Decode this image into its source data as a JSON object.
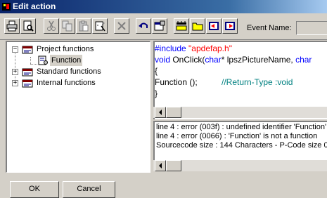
{
  "window": {
    "title": "Edit action"
  },
  "toolbar": {
    "buttons": [
      "print-icon",
      "print-preview-icon",
      "cut-icon",
      "copy-icon",
      "paste-icon",
      "wizard-icon",
      "delete-icon",
      "undo-icon",
      "properties-icon",
      "compile-icon",
      "folder-icon",
      "import-icon",
      "export-icon"
    ],
    "event_name_label": "Event Name:",
    "event_name_value": ""
  },
  "tree": {
    "items": [
      {
        "label": "Project functions",
        "expanded": true
      },
      {
        "label": "Function",
        "selected": true
      },
      {
        "label": "Standard functions",
        "expanded": false
      },
      {
        "label": "Internal functions",
        "expanded": false
      }
    ]
  },
  "code": {
    "line1_directive": "#include ",
    "line1_string": "\"apdefap.h\"",
    "line2_kw1": "void",
    "line2_text1": " OnClick(",
    "line2_kw2": "char",
    "line2_text2": "* lpszPictureName, ",
    "line2_kw3": "char",
    "line3": "{",
    "line4_text": "Function ();",
    "line4_comment": "//Return-Type :void",
    "line5": "}"
  },
  "messages": {
    "lines": [
      "line 4 : error (003f) : undefined identifier 'Function'",
      "line 4 : error (0066) : 'Function' is not a function",
      "Sourcecode size : 144 Characters  -  P-Code size 0"
    ]
  },
  "buttons": {
    "ok": "OK",
    "cancel": "Cancel"
  },
  "colors": {
    "keyword": "#0000ff",
    "string": "#ff0000",
    "comment": "#008080",
    "title_bar": "#0a246a"
  }
}
